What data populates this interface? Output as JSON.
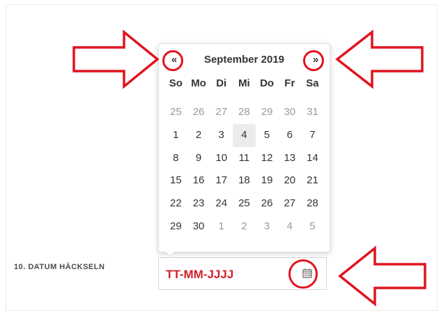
{
  "form": {
    "field_label": "10. DATUM HÄCKSELN",
    "date_input": {
      "value": "",
      "placeholder": "TT-MM-JJJJ"
    },
    "calendar_button_icon": "calendar-icon"
  },
  "datepicker": {
    "prev": "«",
    "next": "»",
    "title": "September 2019",
    "weekdays": [
      "So",
      "Mo",
      "Di",
      "Mi",
      "Do",
      "Fr",
      "Sa"
    ],
    "days": [
      "25",
      "26",
      "27",
      "28",
      "29",
      "30",
      "31",
      "1",
      "2",
      "3",
      "4",
      "5",
      "6",
      "7",
      "8",
      "9",
      "10",
      "11",
      "12",
      "13",
      "14",
      "15",
      "16",
      "17",
      "18",
      "19",
      "20",
      "21",
      "22",
      "23",
      "24",
      "25",
      "26",
      "27",
      "28",
      "29",
      "30",
      "1",
      "2",
      "3",
      "4",
      "5"
    ],
    "today": "4"
  },
  "annotations": {
    "color": "#e0141e",
    "arrow_icon": "red-outline-arrow-icon",
    "circle_icon": "red-circle-highlight"
  },
  "colors": {
    "accent_red": "#d21f2a",
    "today_bg": "#ececec",
    "muted_day": "#9a9a9a"
  }
}
